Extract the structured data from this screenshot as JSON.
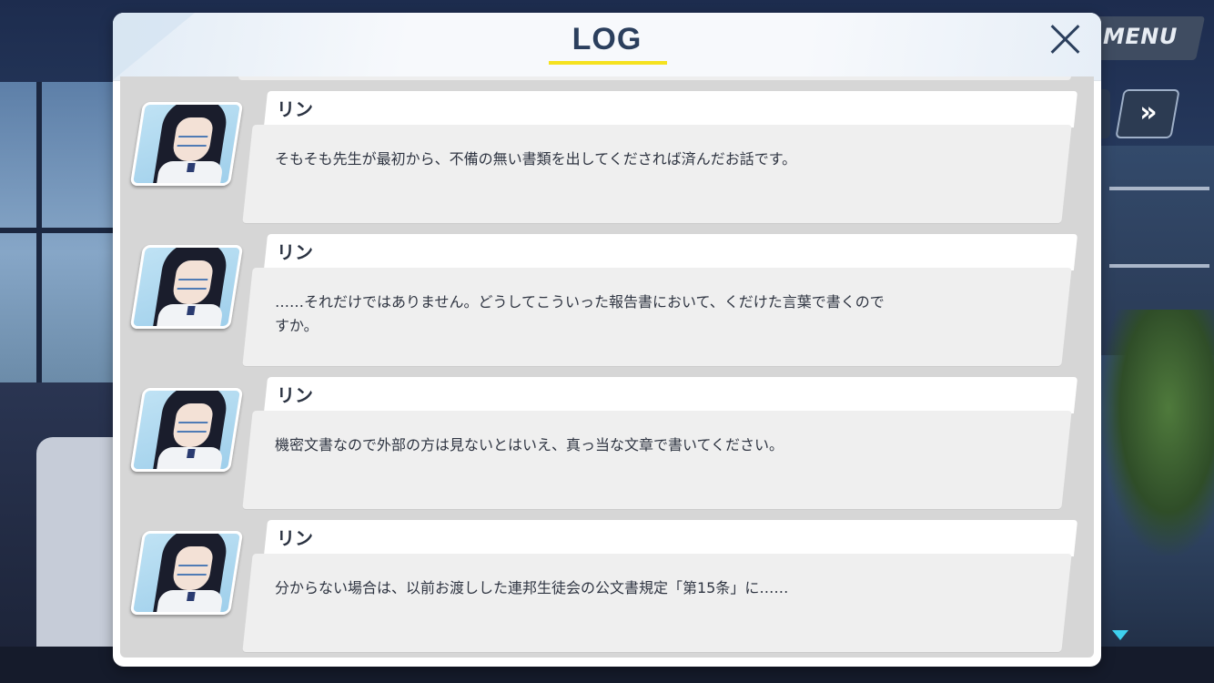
{
  "modal": {
    "title": "LOG",
    "close_label": ""
  },
  "background_controls": {
    "menu_label": "MENU",
    "skip_icon": "»"
  },
  "entries": [
    {
      "speaker": "リン",
      "text": "そもそも先生が最初から、不備の無い書類を出してくだされば済んだお話です。"
    },
    {
      "speaker": "リン",
      "text": "……それだけではありません。どうしてこういった報告書において、くだけた言葉で書くので\nすか。"
    },
    {
      "speaker": "リン",
      "text": "機密文書なので外部の方は見ないとはいえ、真っ当な文章で書いてください。"
    },
    {
      "speaker": "リン",
      "text": "分からない場合は、以前お渡しした連邦生徒会の公文書規定「第15条」に……"
    }
  ],
  "colors": {
    "title": "#2b3f5d",
    "underline": "#f5e21f",
    "scroll_indicator": "#3ed0ee"
  }
}
